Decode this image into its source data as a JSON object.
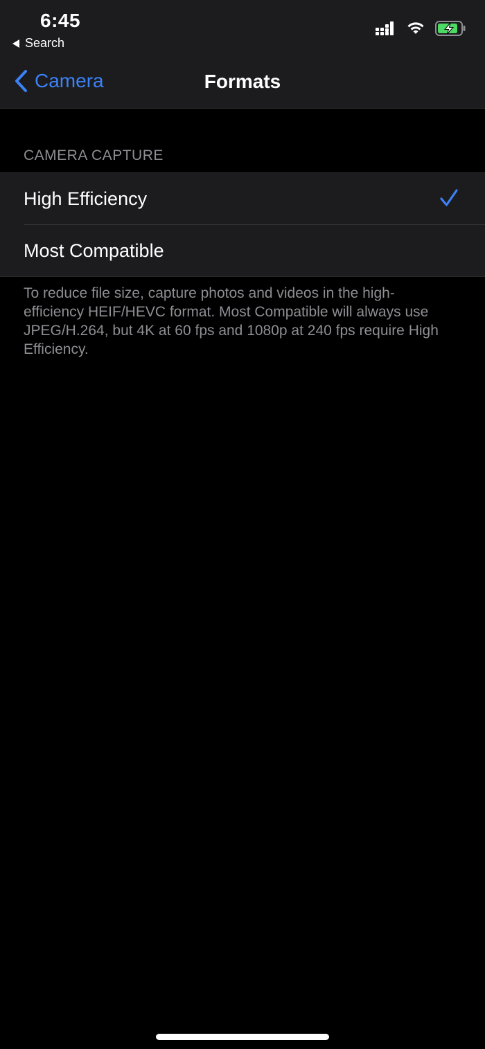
{
  "status_bar": {
    "time": "6:45",
    "back_app_label": "Search"
  },
  "nav": {
    "back_label": "Camera",
    "title": "Formats"
  },
  "section": {
    "header": "CAMERA CAPTURE",
    "options": [
      {
        "label": "High Efficiency",
        "selected": true
      },
      {
        "label": "Most Compatible",
        "selected": false
      }
    ],
    "footer": "To reduce file size, capture photos and videos in the high-efficiency HEIF/HEVC format. Most Compatible will always use JPEG/H.264, but 4K at 60 fps and 1080p at 240 fps require High Efficiency."
  },
  "colors": {
    "accent": "#3b82f6",
    "background": "#000000",
    "group_background": "#1c1c1e",
    "secondary_text": "#8e8e93",
    "battery_fill": "#4cd964"
  },
  "icons": {
    "signal": "cellular-signal-icon",
    "wifi": "wifi-icon",
    "battery": "battery-charging-icon",
    "back": "chevron-left-icon",
    "check": "checkmark-icon"
  }
}
